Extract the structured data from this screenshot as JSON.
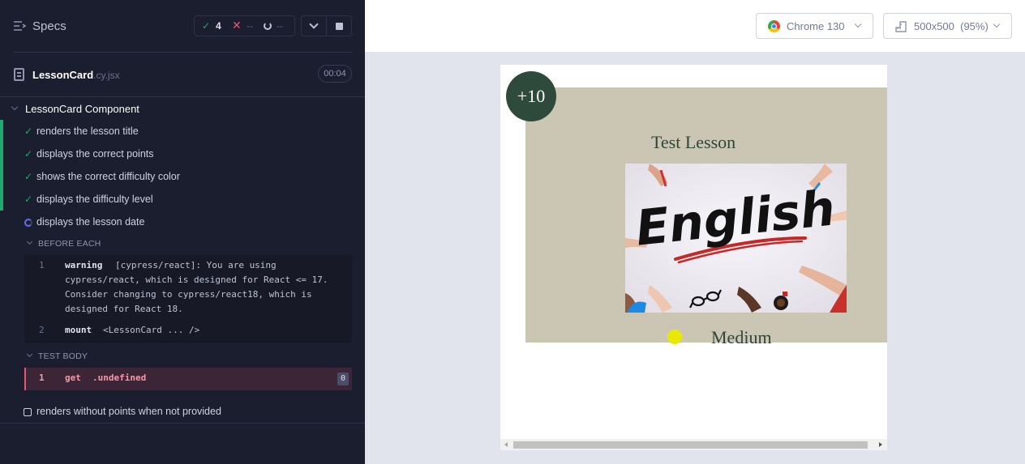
{
  "header": {
    "specs_label": "Specs",
    "stats": {
      "passed_icon": "✓",
      "passed": "4",
      "failed_icon": "✕",
      "failed": "--",
      "pending": "--"
    },
    "controls": {
      "collapse_icon": "chevron-down-icon",
      "stop_icon": "stop-icon"
    }
  },
  "spec_file": {
    "name": "LessonCard",
    "ext": ".cy.jsx",
    "duration": "00:04"
  },
  "suite": {
    "title": "LessonCard Component",
    "tests": [
      {
        "label": "renders the lesson title",
        "state": "passed"
      },
      {
        "label": "displays the correct points",
        "state": "passed"
      },
      {
        "label": "shows the correct difficulty color",
        "state": "passed"
      },
      {
        "label": "displays the difficulty level",
        "state": "passed"
      },
      {
        "label": "displays the lesson date",
        "state": "running"
      },
      {
        "label": "renders without points when not provided",
        "state": "pending"
      }
    ]
  },
  "before_each": {
    "title": "BEFORE EACH",
    "commands": [
      {
        "num": "1",
        "name": "warning",
        "message": "[cypress/react]: You are using",
        "message_wrap": "cypress/react, which is designed for React <= 17.\nConsider changing to cypress/react18, which is\ndesigned for React 18."
      },
      {
        "num": "2",
        "name": "mount",
        "message": "<LessonCard ... />"
      }
    ]
  },
  "test_body": {
    "title": "TEST BODY",
    "commands": [
      {
        "num": "1",
        "name": "get",
        "message": ".undefined",
        "badge": "0"
      }
    ]
  },
  "aut_header": {
    "browser": "Chrome 130",
    "viewport": "500x500",
    "scale": "(95%)"
  },
  "lesson_card": {
    "points": "+10",
    "title": "Test Lesson",
    "image_text": "English",
    "difficulty": "Medium",
    "difficulty_color": "#e8e800",
    "card_color": "#cbc5b4",
    "points_color": "#2e4a3b"
  },
  "colors": {
    "passed": "#1fa971",
    "failed": "#e45770",
    "running": "#6470f3",
    "reporter_bg": "#1b1e2e"
  }
}
